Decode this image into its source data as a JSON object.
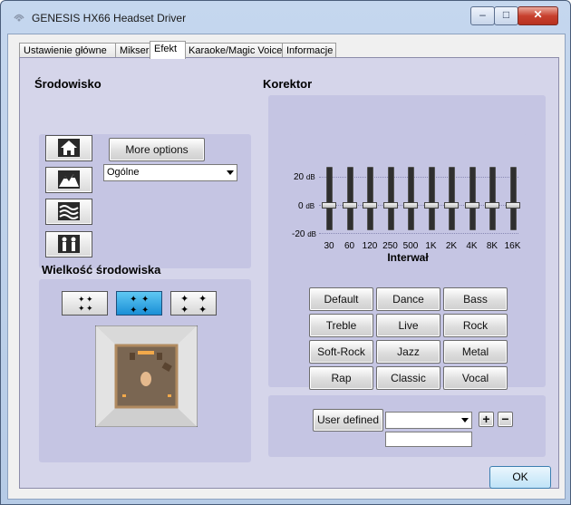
{
  "window": {
    "title": "GENESIS HX66 Headset Driver",
    "min_glyph": "–",
    "max_glyph": "□",
    "close_glyph": "✕"
  },
  "tabs": [
    {
      "label": "Ustawienie główne",
      "active": false
    },
    {
      "label": "Mikser",
      "active": false
    },
    {
      "label": "Efekt",
      "active": true
    },
    {
      "label": "Karaoke/Magic Voice",
      "active": false
    },
    {
      "label": "Informacje",
      "active": false
    }
  ],
  "environment": {
    "title": "Środowisko",
    "buttons": [
      "house-icon",
      "mountains-icon",
      "water-icon",
      "people-icon"
    ],
    "more_options_label": "More options",
    "selected": "Ogólne"
  },
  "environment_size": {
    "title": "Wielkość środowiska",
    "options": [
      "small-room-icon",
      "medium-room-icon",
      "large-room-icon"
    ],
    "selected_index": 1
  },
  "equalizer": {
    "title": "Korektor",
    "db_labels": {
      "top": "20",
      "mid": "0",
      "bottom": "-20",
      "unit": "dB"
    },
    "axis_label": "Interwał",
    "bands": [
      {
        "freq": "30",
        "gain_db": 0
      },
      {
        "freq": "60",
        "gain_db": 0
      },
      {
        "freq": "120",
        "gain_db": 0
      },
      {
        "freq": "250",
        "gain_db": 0
      },
      {
        "freq": "500",
        "gain_db": 0
      },
      {
        "freq": "1K",
        "gain_db": 0
      },
      {
        "freq": "2K",
        "gain_db": 0
      },
      {
        "freq": "4K",
        "gain_db": 0
      },
      {
        "freq": "8K",
        "gain_db": 0
      },
      {
        "freq": "16K",
        "gain_db": 0
      }
    ],
    "presets": [
      "Default",
      "Dance",
      "Bass",
      "Treble",
      "Live",
      "Rock",
      "Soft-Rock",
      "Jazz",
      "Metal",
      "Rap",
      "Classic",
      "Vocal"
    ],
    "user_defined_label": "User defined",
    "user_defined_selected": "",
    "add_label": "+",
    "remove_label": "−",
    "name_value": ""
  },
  "ok_label": "OK"
}
